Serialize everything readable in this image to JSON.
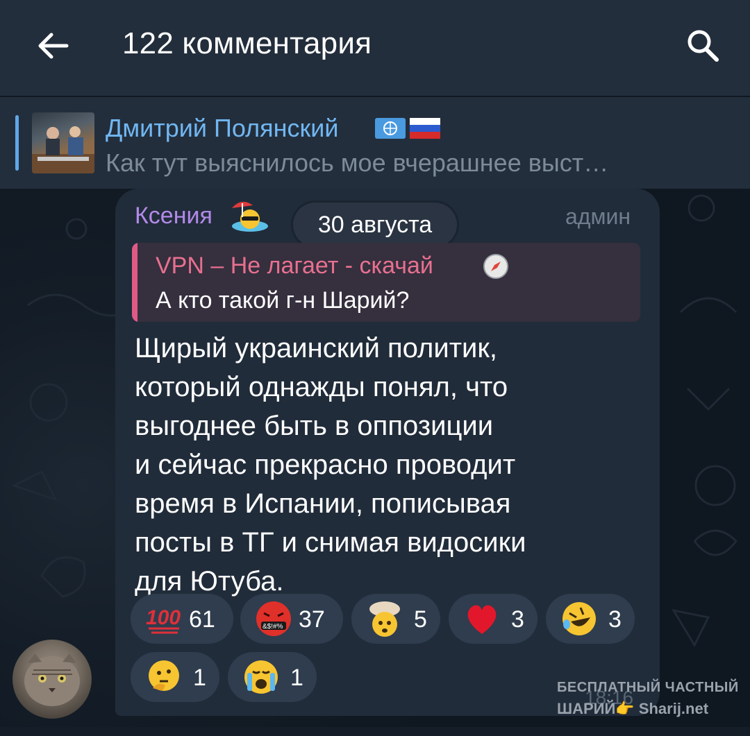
{
  "header": {
    "title": "122 комментария",
    "back_icon": "arrow-left-icon",
    "search_icon": "search-icon"
  },
  "original_post": {
    "author": "Дмитрий Полянский",
    "author_badges": [
      "un-flag-icon",
      "russia-flag-icon"
    ],
    "preview": "Как тут выяснилось мое вчерашнее выст…",
    "accent_color": "#5fa8e8"
  },
  "date_pill": "30 августа",
  "message": {
    "sender": "Ксения",
    "sender_emoji": "beach-umbrella-cool-face-emoji",
    "role": "админ",
    "reply": {
      "author": "VPN – Не лагает - скачай",
      "author_emoji": "compass-icon",
      "text": "А кто такой г-н Шарий?"
    },
    "lines": [
      "Щирый украинский политик,",
      "который однажды понял, что",
      "выгоднее быть в оппозиции",
      "и сейчас прекрасно проводит",
      "время в Испании, пописывая",
      "посты в ТГ и снимая видосики",
      "для Ютуба."
    ],
    "reactions": [
      {
        "emoji": "hundred-points-emoji",
        "count": "61"
      },
      {
        "emoji": "cursing-face-emoji",
        "count": "37"
      },
      {
        "emoji": "exploding-head-emoji",
        "count": "5"
      },
      {
        "emoji": "red-heart-emoji",
        "count": "3"
      },
      {
        "emoji": "rolling-laughing-emoji",
        "count": "3"
      },
      {
        "emoji": "thinking-face-emoji",
        "count": "1"
      },
      {
        "emoji": "crying-face-emoji",
        "count": "1"
      }
    ],
    "time": "18:16"
  },
  "watermark": {
    "line1": "БЕСПЛАТНЫЙ ЧАСТНЫЙ",
    "line2": "ШАРИЙ👉 Sharij.net"
  },
  "colors": {
    "header_bg": "#232e3c",
    "bubble_bg": "#212c3a",
    "sender_name": "#b28ae8",
    "reply_name": "#e8708f",
    "link_blue": "#71b7f2"
  }
}
